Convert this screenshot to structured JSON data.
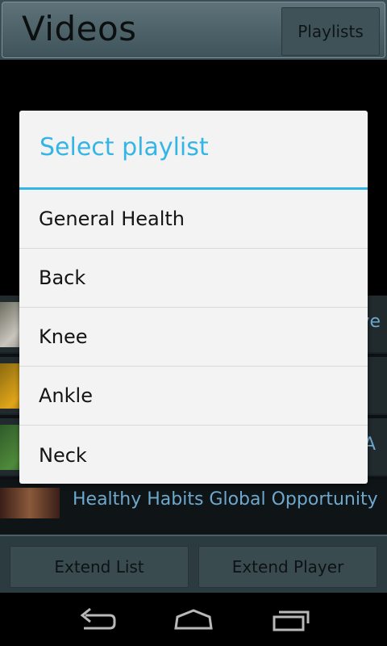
{
  "header": {
    "title": "Videos",
    "playlists_label": "Playlists"
  },
  "list": {
    "rows": [
      {
        "title": "ve"
      },
      {
        "title": ""
      },
      {
        "title": "A"
      },
      {
        "title": "Healthy Habits Global Opportunity"
      }
    ]
  },
  "bottom": {
    "extend_list_label": "Extend List",
    "extend_player_label": "Extend Player"
  },
  "dialog": {
    "title": "Select playlist",
    "options": [
      "General Health",
      "Back",
      "Knee",
      "Ankle",
      "Neck"
    ]
  },
  "nav": {
    "back_icon": "back-icon",
    "home_icon": "home-icon",
    "recents_icon": "recents-icon"
  },
  "colors": {
    "accent": "#33b5e5",
    "dialog_bg": "#f3f3f3",
    "header_bg": "#4f646b"
  }
}
